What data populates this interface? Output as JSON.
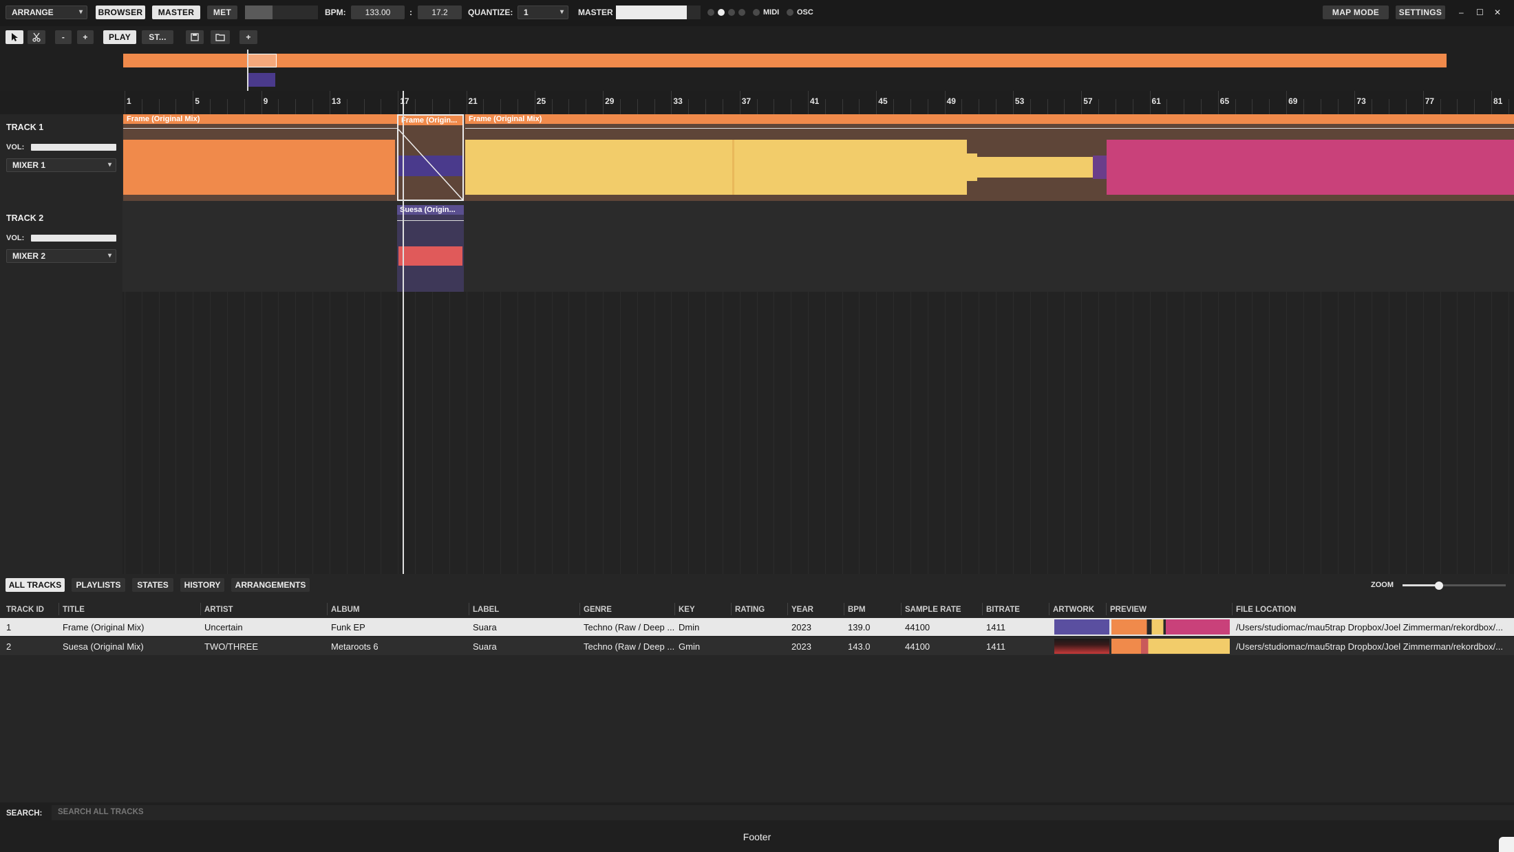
{
  "topbar": {
    "mode_select": "ARRANGE",
    "browser_btn": "BROWSER",
    "master_btn": "MASTER",
    "met_btn": "MET",
    "bpm_label": "BPM:",
    "bpm_value": "133.00",
    "colon": ":",
    "sync_value": "17.2",
    "quantize_label": "QUANTIZE:",
    "quantize_value": "1",
    "master_label": "MASTER",
    "midi_label": "MIDI",
    "osc_label": "OSC",
    "map_mode": "MAP MODE",
    "settings": "SETTINGS",
    "minimize": "–",
    "maximize": "☐",
    "close": "✕"
  },
  "toolbar": {
    "select_icon": "cursor-icon",
    "cut_icon": "scissors-icon",
    "zoom_out": "-",
    "zoom_in": "+",
    "play": "PLAY",
    "stop": "ST...",
    "save_icon": "save-icon",
    "folder_icon": "folder-icon",
    "add": "+"
  },
  "ruler": {
    "bars": [
      "1",
      "5",
      "9",
      "13",
      "17",
      "21",
      "25",
      "29",
      "33",
      "37",
      "41",
      "45",
      "49",
      "53",
      "57",
      "61",
      "65",
      "69",
      "73",
      "77",
      "81"
    ]
  },
  "tracks": [
    {
      "title": "TRACK 1",
      "vol_label": "VOL:",
      "vol_level": 1.0,
      "mixer": "MIXER 1",
      "clips": [
        {
          "label": "Frame (Original Mix)",
          "color": "#f08a4b"
        },
        {
          "label": "Frame (Origin...",
          "color": "#f08a4b"
        },
        {
          "label": "Frame (Original Mix)",
          "color": "#f08a4b"
        }
      ]
    },
    {
      "title": "TRACK 2",
      "vol_label": "VOL:",
      "vol_level": 1.0,
      "mixer": "MIXER 2",
      "clips": [
        {
          "label": "Suesa (Origin...",
          "color": "#5a4f8f"
        }
      ]
    }
  ],
  "colors": {
    "orange": "#f08a4b",
    "yellow": "#f2cc6a",
    "pink": "#c9417a",
    "purple": "#4a3a8c",
    "clip_bg": "#6a4a3e"
  },
  "browser": {
    "tabs": [
      "ALL TRACKS",
      "PLAYLISTS",
      "STATES",
      "HISTORY",
      "ARRANGEMENTS"
    ],
    "zoom_label": "ZOOM",
    "zoom_level": 0.35,
    "columns": [
      "TRACK ID",
      "TITLE",
      "ARTIST",
      "ALBUM",
      "LABEL",
      "GENRE",
      "KEY",
      "RATING",
      "YEAR",
      "BPM",
      "SAMPLE RATE",
      "BITRATE",
      "ARTWORK",
      "PREVIEW",
      "FILE LOCATION"
    ],
    "rows": [
      [
        "1",
        "Frame (Original Mix)",
        "Uncertain",
        "Funk EP",
        "Suara",
        "Techno (Raw / Deep ...",
        "Dmin",
        "",
        "2023",
        "139.0",
        "44100",
        "1411",
        "",
        "",
        "/Users/studiomac/mau5trap Dropbox/Joel Zimmerman/rekordbox/..."
      ],
      [
        "2",
        "Suesa (Original Mix)",
        "TWO/THREE",
        "Metaroots 6",
        "Suara",
        "Techno (Raw / Deep ...",
        "Gmin",
        "",
        "2023",
        "143.0",
        "44100",
        "1411",
        "",
        "",
        "/Users/studiomac/mau5trap Dropbox/Joel Zimmerman/rekordbox/..."
      ]
    ]
  },
  "search": {
    "label": "SEARCH:",
    "placeholder": "SEARCH ALL TRACKS"
  },
  "footer": {
    "text": "Footer"
  }
}
